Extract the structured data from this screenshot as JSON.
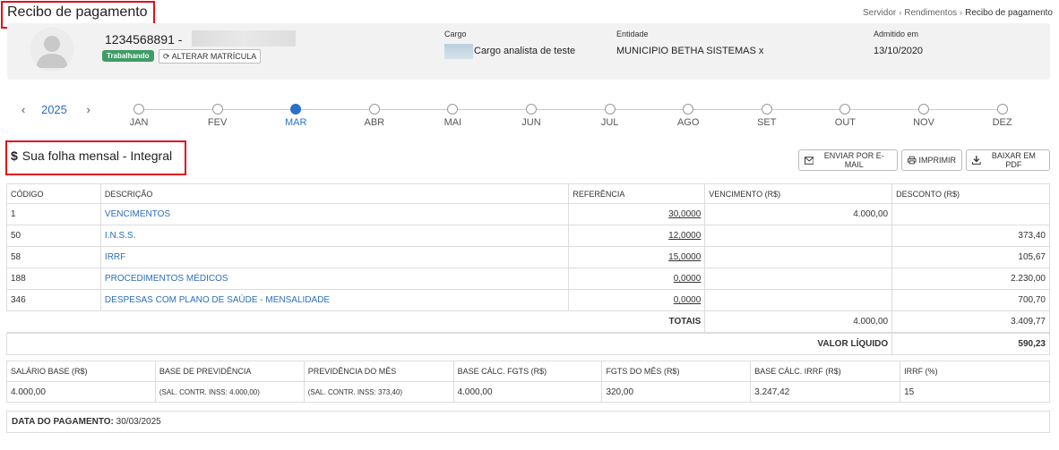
{
  "page": {
    "title": "Recibo de pagamento"
  },
  "breadcrumb": {
    "items": [
      "Servidor",
      "Rendimentos"
    ],
    "current": "Recibo de pagamento"
  },
  "employee": {
    "matricula": "1234568891 -",
    "status": "Trabalhando",
    "alterar_label": "ALTERAR MATRÍCULA",
    "cargo_label": "Cargo",
    "cargo_value": "Cargo analista de teste",
    "entidade_label": "Entidade",
    "entidade_value": "MUNICIPIO BETHA SISTEMAS x",
    "admitido_label": "Admitido em",
    "admitido_value": "13/10/2020"
  },
  "year": "2025",
  "months": [
    {
      "label": "JAN",
      "active": false
    },
    {
      "label": "FEV",
      "active": false
    },
    {
      "label": "MAR",
      "active": true
    },
    {
      "label": "ABR",
      "active": false
    },
    {
      "label": "MAI",
      "active": false
    },
    {
      "label": "JUN",
      "active": false
    },
    {
      "label": "JUL",
      "active": false
    },
    {
      "label": "AGO",
      "active": false
    },
    {
      "label": "SET",
      "active": false
    },
    {
      "label": "OUT",
      "active": false
    },
    {
      "label": "NOV",
      "active": false
    },
    {
      "label": "DEZ",
      "active": false
    }
  ],
  "folha": {
    "title": "Sua folha mensal - Integral"
  },
  "actions": {
    "email": "ENVIAR POR E-MAIL",
    "print": "IMPRIMIR",
    "pdf": "BAIXAR EM PDF"
  },
  "table": {
    "headers": [
      "CÓDIGO",
      "DESCRIÇÃO",
      "REFERÊNCIA",
      "VENCIMENTO (R$)",
      "DESCONTO (R$)"
    ],
    "rows": [
      {
        "codigo": "1",
        "descricao": "VENCIMENTOS",
        "referencia": "30,0000",
        "vencimento": "4.000,00",
        "desconto": ""
      },
      {
        "codigo": "50",
        "descricao": "I.N.S.S.",
        "referencia": "12,0000",
        "vencimento": "",
        "desconto": "373,40"
      },
      {
        "codigo": "58",
        "descricao": "IRRF",
        "referencia": "15,0000",
        "vencimento": "",
        "desconto": "105,67"
      },
      {
        "codigo": "188",
        "descricao": "PROCEDIMENTOS MÉDICOS",
        "referencia": "0,0000",
        "vencimento": "",
        "desconto": "2.230,00"
      },
      {
        "codigo": "346",
        "descricao": "DESPESAS COM PLANO DE SAÚDE - MENSALIDADE",
        "referencia": "0,0000",
        "vencimento": "",
        "desconto": "700,70"
      }
    ],
    "totais_label": "TOTAIS",
    "totais_vencimento": "4.000,00",
    "totais_desconto": "3.409,77",
    "liquido_label": "VALOR LÍQUIDO",
    "liquido_value": "590,23"
  },
  "bases": {
    "headers": [
      "SALÁRIO BASE (R$)",
      "BASE DE PREVIDÊNCIA",
      "PREVIDÊNCIA DO MÊS",
      "BASE CÁLC. FGTS (R$)",
      "FGTS DO MÊS (R$)",
      "BASE CÁLC. IRRF (R$)",
      "IRRF (%)"
    ],
    "values": [
      "4.000,00",
      "(SAL. CONTR. INSS: 4.000,00)",
      "(SAL. CONTR. INSS: 373,40)",
      "4.000,00",
      "320,00",
      "3.247,42",
      "15"
    ]
  },
  "pagamento": {
    "label": "DATA DO PAGAMENTO:",
    "value": "30/03/2025"
  }
}
